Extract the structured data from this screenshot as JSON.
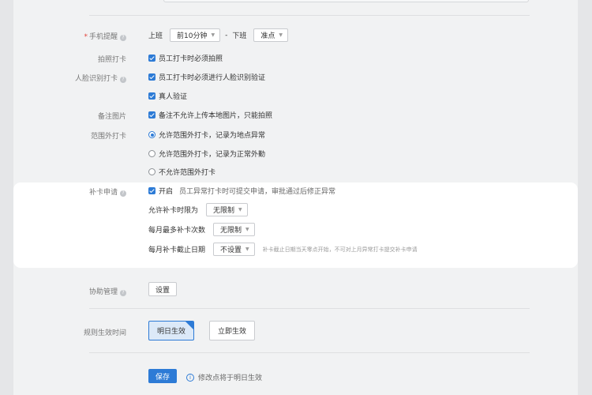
{
  "reminder": {
    "label": "手机提醒",
    "on_duty": "上班",
    "on_duty_select": "前10分钟",
    "dash": "-",
    "off_duty": "下班",
    "off_duty_select": "准点"
  },
  "photo": {
    "label": "拍照打卡",
    "option": "员工打卡时必须拍照"
  },
  "face": {
    "label": "人脸识别打卡",
    "option1": "员工打卡时必须进行人脸识别验证",
    "option2": "真人验证"
  },
  "remark": {
    "label": "备注图片",
    "option": "备注不允许上传本地图片，只能拍照"
  },
  "outside": {
    "label": "范围外打卡",
    "options": [
      "允许范围外打卡，记录为地点异常",
      "允许范围外打卡，记录为正常外勤",
      "不允许范围外打卡"
    ],
    "selected_index": 0
  },
  "makeup": {
    "label": "补卡申请",
    "enable": "开启",
    "enable_desc": "员工异常打卡时可提交申请，审批通过后修正异常",
    "time_limit_label": "允许补卡时限为",
    "time_limit_value": "无限制",
    "max_count_label": "每月最多补卡次数",
    "max_count_value": "无限制",
    "deadline_label": "每月补卡截止日期",
    "deadline_value": "不设置",
    "deadline_hint": "补卡截止日期当天零点开始，不可对上月异常打卡提交补卡申请"
  },
  "assist": {
    "label": "协助管理",
    "button": "设置"
  },
  "effective": {
    "label": "规则生效时间",
    "tomorrow": "明日生效",
    "now": "立即生效"
  },
  "footer": {
    "save": "保存",
    "note": "修改点将于明日生效"
  },
  "colors": {
    "accent": "#2d7bd6",
    "required": "#e3433a"
  }
}
